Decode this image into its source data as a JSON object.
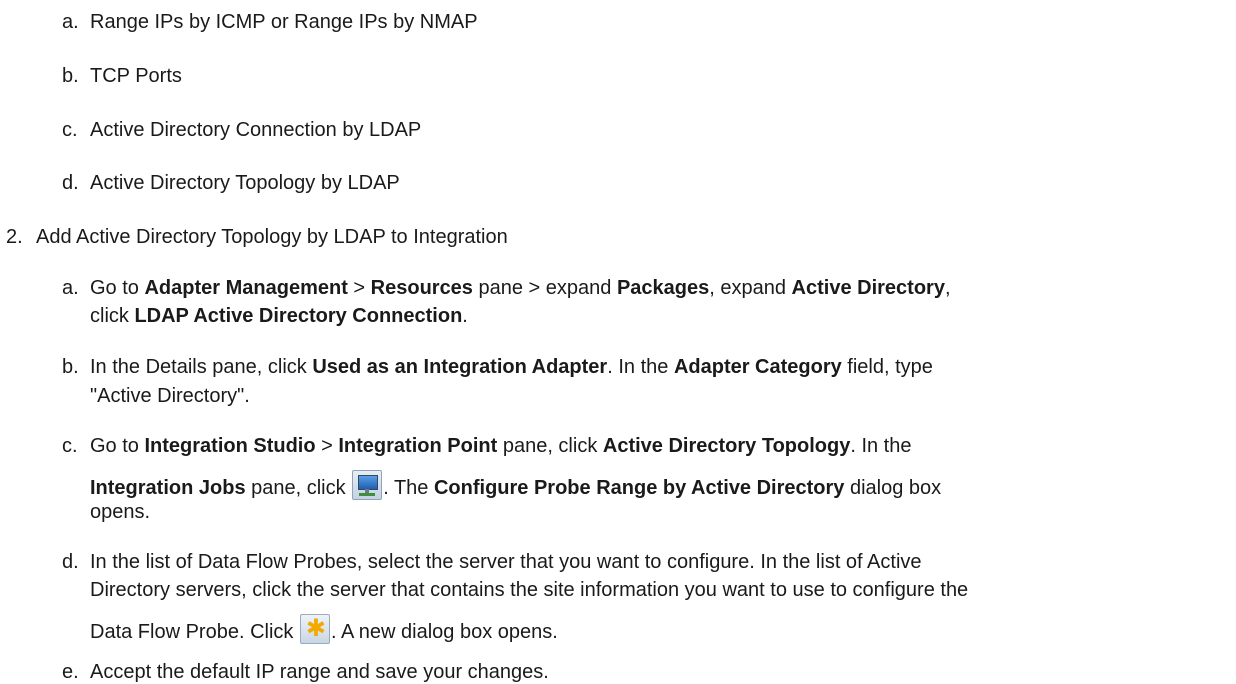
{
  "items": {
    "a1": {
      "marker": "a.",
      "text": "Range IPs by ICMP or Range IPs by NMAP"
    },
    "b1": {
      "marker": "b.",
      "text": "TCP Ports"
    },
    "c1": {
      "marker": "c.",
      "text": "Active Directory Connection by LDAP"
    },
    "d1": {
      "marker": "d.",
      "text": "Active Directory Topology by LDAP"
    },
    "step2": {
      "marker": "2.",
      "text": "Add Active Directory Topology by LDAP to Integration"
    }
  },
  "step2_sub": {
    "a": {
      "marker": "a.",
      "t1": "Go to ",
      "b1": "Adapter Management",
      "t2": " > ",
      "b2": "Resources",
      "t3": " pane > expand ",
      "b3": "Packages",
      "t4": ", expand ",
      "b4": "Active Directory",
      "t5": ",",
      "t6": "click ",
      "b5": "LDAP Active Directory Connection",
      "t7": "."
    },
    "b": {
      "marker": "b.",
      "t1": "In the Details pane, click ",
      "b1": "Used as an Integration Adapter",
      "t2": ". In the ",
      "b2": "Adapter Category",
      "t3": " field, type",
      "t4": "\"Active Directory\"."
    },
    "c": {
      "marker": "c.",
      "t1": "Go to ",
      "b1": "Integration Studio",
      "t2": " > ",
      "b2": "Integration Point",
      "t3": " pane, click ",
      "b3": "Active Directory Topology",
      "t4": ". In the",
      "b4": "Integration Jobs",
      "t5": " pane, click ",
      "t6": ". The ",
      "b5": "Configure Probe Range by Active Directory",
      "t7": " dialog box",
      "t8": "opens."
    },
    "d": {
      "marker": "d.",
      "t1": "In the list of Data Flow Probes, select the server that you want to configure. In the list of Active",
      "t2": "Directory servers, click the server that contains the site information you want to use to configure the",
      "t3": "Data Flow Probe. Click ",
      "t4": ". A new dialog box opens."
    },
    "e": {
      "marker": "e.",
      "text": "Accept the default IP range and save your changes."
    }
  },
  "icons": {
    "probe_range": "configure-probe-range-icon",
    "new_item": "new-item-star-icon",
    "star_color": "#f2a900"
  }
}
